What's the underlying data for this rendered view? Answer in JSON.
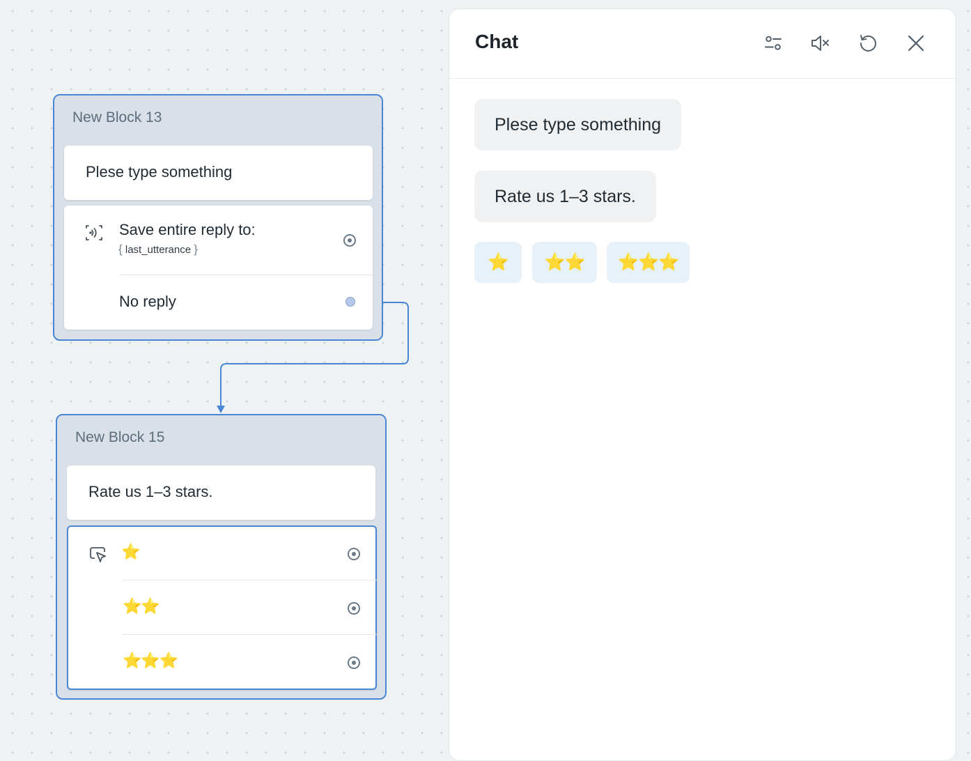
{
  "canvas": {
    "block13": {
      "title": "New Block 13",
      "message": "Plese type something",
      "capture": {
        "label": "Save entire reply to:",
        "brace_open": "{",
        "variable": "last_utterance",
        "brace_close": "}"
      },
      "no_reply": "No reply"
    },
    "block15": {
      "title": "New Block 15",
      "message": "Rate us 1–3 stars.",
      "choices": [
        "⭐",
        "⭐⭐",
        "⭐⭐⭐"
      ]
    }
  },
  "chat": {
    "title": "Chat",
    "icons": [
      "settings-sliders-icon",
      "mute-icon",
      "restart-icon",
      "close-icon"
    ],
    "messages": [
      "Plese type something",
      "Rate us 1–3 stars."
    ],
    "buttons": [
      "⭐",
      "⭐⭐",
      "⭐⭐⭐"
    ]
  },
  "colors": {
    "accent": "#4a86d6",
    "block_bg": "#d9e0e7",
    "bubble_bg": "#f0f1f2",
    "button_bg": "#e6f1fa"
  }
}
